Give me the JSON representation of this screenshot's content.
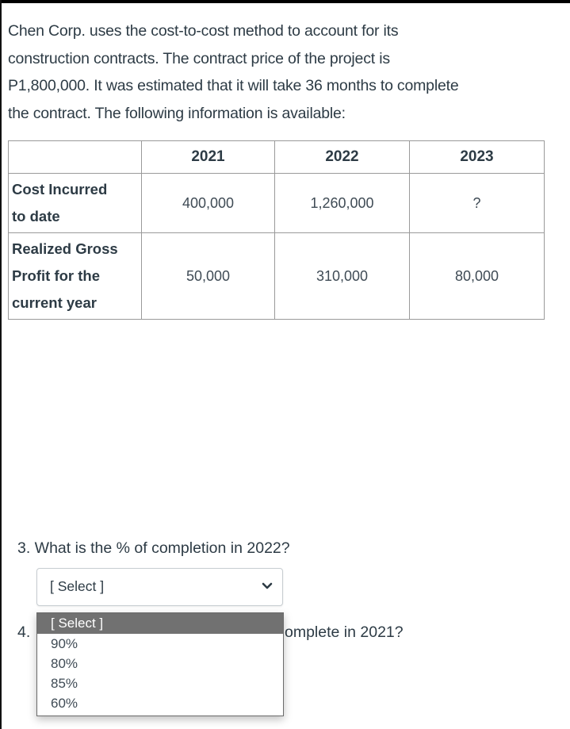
{
  "intro": {
    "lines": [
      "Chen Corp. uses the cost-to-cost method to account for its",
      "construction contracts. The contract price of the project is",
      "P1,800,000. It was estimated that it will take 36 months to complete",
      "the contract. The following information is available:"
    ]
  },
  "table": {
    "headers": [
      "",
      "2021",
      "2022",
      "2023"
    ],
    "rows": [
      {
        "label_lines": [
          "Cost Incurred",
          "to date"
        ],
        "values": [
          "400,000",
          "1,260,000",
          "?"
        ]
      },
      {
        "label_lines": [
          "Realized Gross",
          "Profit for the",
          "current year"
        ],
        "values": [
          "50,000",
          "310,000",
          "80,000"
        ]
      }
    ]
  },
  "question3": {
    "text": "3. What is the % of completion in 2022?",
    "select": {
      "value": "[ Select ]",
      "icon": "chevron-down-icon"
    }
  },
  "question4": {
    "number": "4.",
    "visible_tail": "omplete in 2021?"
  },
  "dropdown": {
    "options": [
      "[ Select ]",
      "90%",
      "80%",
      "85%",
      "60%"
    ],
    "highlighted_index": 0
  },
  "colors": {
    "text": "#2d3b45",
    "table_border": "#9a9a9a",
    "option_highlight": "#717171"
  }
}
